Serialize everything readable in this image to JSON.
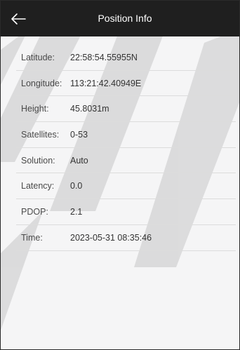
{
  "header": {
    "title": "Position Info",
    "back_icon": "arrow-left-icon"
  },
  "rows": [
    {
      "label": "Latitude:",
      "value": "22:58:54.55955N"
    },
    {
      "label": "Longitude:",
      "value": "113:21:42.40949E"
    },
    {
      "label": "Height:",
      "value": "45.8031m"
    },
    {
      "label": "Satellites:",
      "value": "0-53"
    },
    {
      "label": "Solution:",
      "value": "Auto"
    },
    {
      "label": "Latency:",
      "value": "0.0"
    },
    {
      "label": "PDOP:",
      "value": "2.1"
    },
    {
      "label": "Time:",
      "value": "2023-05-31 08:35:46"
    }
  ],
  "colors": {
    "header_bg": "#1f1f1f",
    "page_bg": "#f5f5f6",
    "divider": "#dcdcdc"
  }
}
